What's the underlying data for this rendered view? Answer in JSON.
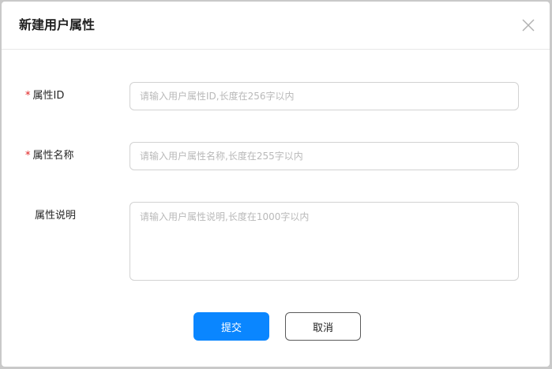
{
  "dialog": {
    "title": "新建用户属性",
    "close_icon": "close-icon"
  },
  "form": {
    "required_mark": "*",
    "attr_id": {
      "label": "属性ID",
      "required": true,
      "value": "",
      "placeholder": "请输入用户属性ID,长度在256字以内"
    },
    "attr_name": {
      "label": "属性名称",
      "required": true,
      "value": "",
      "placeholder": "请输入用户属性名称,长度在255字以内"
    },
    "attr_desc": {
      "label": "属性说明",
      "required": false,
      "value": "",
      "placeholder": "请输入用户属性说明,长度在1000字以内"
    }
  },
  "buttons": {
    "submit_label": "提交",
    "cancel_label": "取消"
  },
  "colors": {
    "primary": "#0a86ff",
    "required": "#e02020",
    "border": "#d2d2d2"
  }
}
